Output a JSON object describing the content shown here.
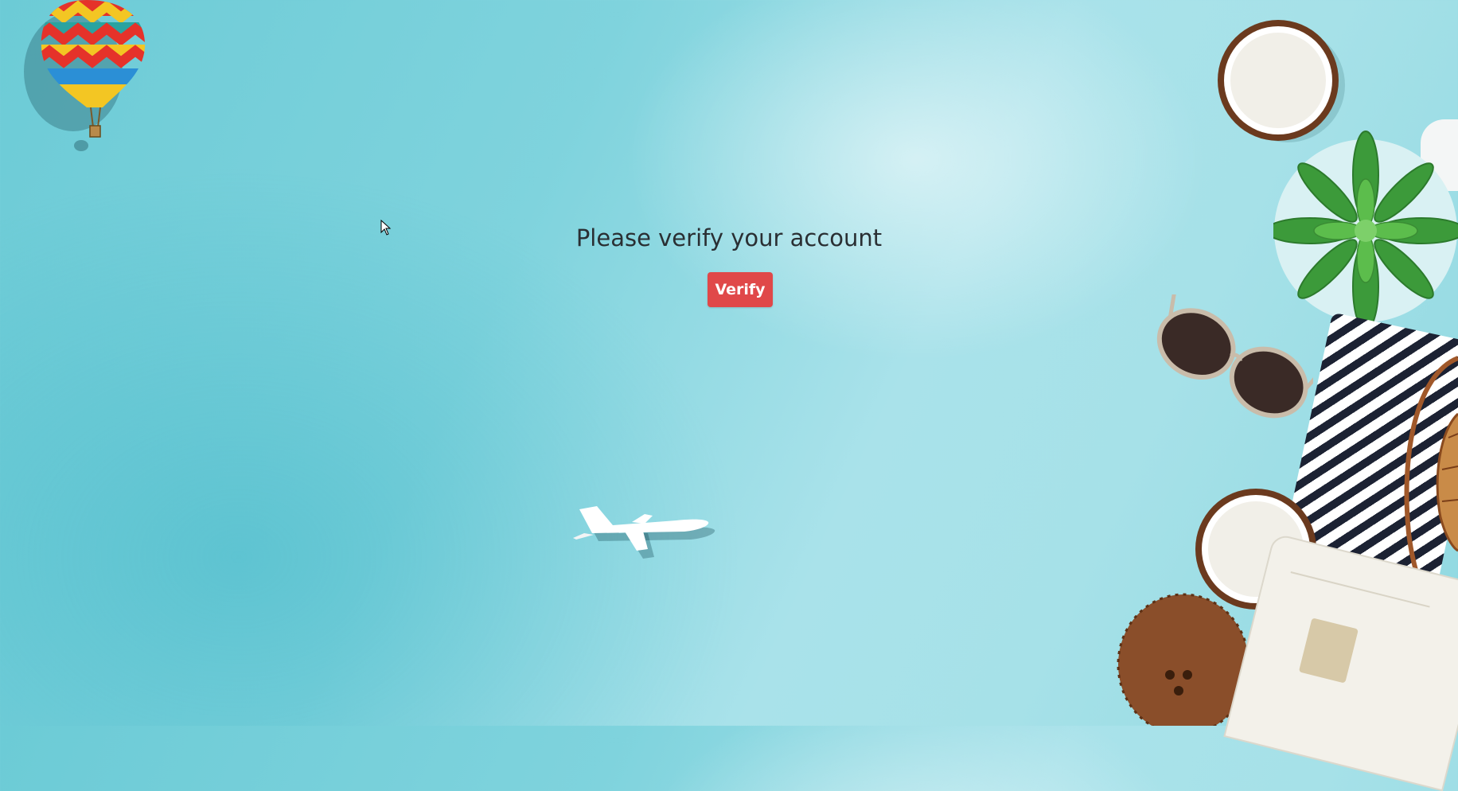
{
  "page": {
    "heading": "Please verify your account",
    "verify_label": "Verify"
  },
  "colors": {
    "background": "#7fd3dd",
    "button": "#e04849",
    "heading_text": "#2a2f33"
  },
  "decorations": [
    "hot-air-balloon-illustration",
    "airplane-illustration",
    "coconut-illustration",
    "succulent-plant-illustration",
    "sunglasses-illustration",
    "striped-towel-illustration",
    "rattan-bag-illustration",
    "white-shorts-illustration"
  ],
  "icons": [
    "mouse-cursor-icon"
  ]
}
